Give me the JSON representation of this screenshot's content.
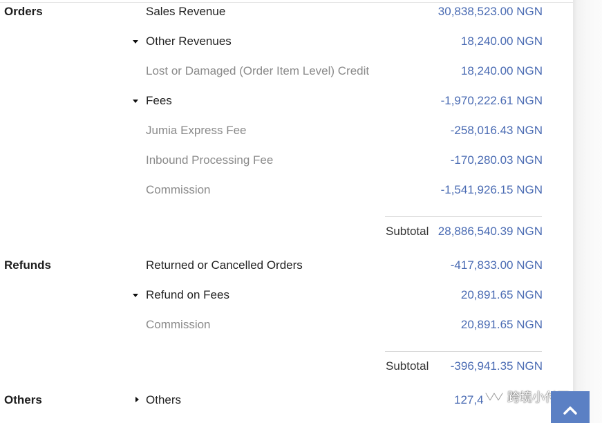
{
  "sections": {
    "orders": {
      "label": "Orders",
      "sales_revenue": {
        "label": "Sales Revenue",
        "value": "30,838,523.00 NGN"
      },
      "other_revenues": {
        "label": "Other Revenues",
        "value": "18,240.00 NGN",
        "expanded": true
      },
      "lost_damaged_credit": {
        "label": "Lost or Damaged (Order Item Level) Credit",
        "value": "18,240.00 NGN"
      },
      "fees": {
        "label": "Fees",
        "value": "-1,970,222.61 NGN",
        "expanded": true
      },
      "jumia_express_fee": {
        "label": "Jumia Express Fee",
        "value": "-258,016.43 NGN"
      },
      "inbound_processing_fee": {
        "label": "Inbound Processing Fee",
        "value": "-170,280.03 NGN"
      },
      "commission": {
        "label": "Commission",
        "value": "-1,541,926.15 NGN"
      },
      "subtotal": {
        "label": "Subtotal",
        "value": "28,886,540.39 NGN"
      }
    },
    "refunds": {
      "label": "Refunds",
      "returned_cancelled": {
        "label": "Returned or Cancelled Orders",
        "value": "-417,833.00 NGN"
      },
      "refund_on_fees": {
        "label": "Refund on Fees",
        "value": "20,891.65 NGN",
        "expanded": true
      },
      "commission": {
        "label": "Commission",
        "value": "20,891.65 NGN"
      },
      "subtotal": {
        "label": "Subtotal",
        "value": "-396,941.35 NGN"
      }
    },
    "others": {
      "label": "Others",
      "others": {
        "label": "Others",
        "value": "127,4",
        "expanded": false
      }
    }
  },
  "watermark": {
    "text": "跨境小付哥",
    "icon": "wechat-channel-icon"
  },
  "scroll_top": {
    "icon": "chevron-up-icon"
  },
  "colors": {
    "value_blue": "#4a6bb3",
    "muted_text": "#8a8a8a",
    "button_blue": "#5b80c4"
  }
}
